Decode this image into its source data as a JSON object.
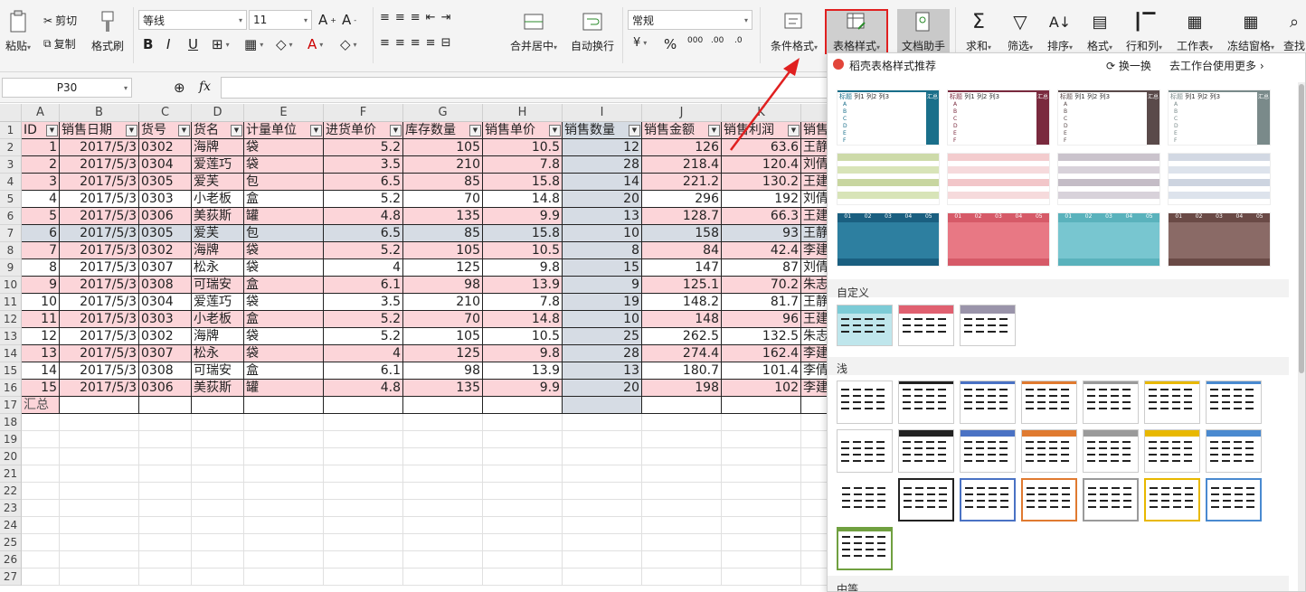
{
  "ribbon": {
    "paste": "粘贴",
    "cut": "剪切",
    "copy": "复制",
    "format_painter": "格式刷",
    "font_name": "等线",
    "font_size": "11",
    "merge_center": "合并居中",
    "wrap_text": "自动换行",
    "number_format": "常规",
    "cond_format": "条件格式",
    "table_style": "表格样式",
    "doc_helper": "文档助手",
    "sum": "求和",
    "filter": "筛选",
    "sort": "排序",
    "format": "格式",
    "row_col": "行和列",
    "worksheet": "工作表",
    "freeze": "冻结窗格",
    "find": "查找",
    "currency": "¥",
    "percent": "%",
    "thousands": "000",
    "inc_decimal": ".00",
    "dec_decimal": ".0"
  },
  "formula_bar": {
    "name_box": "P30",
    "fx": "fx"
  },
  "sheet": {
    "columns": [
      "A",
      "B",
      "C",
      "D",
      "E",
      "F",
      "G",
      "H",
      "I",
      "J",
      "K"
    ],
    "headers": [
      "ID",
      "销售日期",
      "货号",
      "货名",
      "计量单位",
      "进货单价",
      "库存数量",
      "销售单价",
      "销售数量",
      "销售金额",
      "销售利润",
      "销售"
    ],
    "rows": [
      [
        "1",
        "2017/5/3",
        "0302",
        "海牌",
        "袋",
        "5.2",
        "105",
        "10.5",
        "12",
        "126",
        "63.6",
        "王静"
      ],
      [
        "2",
        "2017/5/3",
        "0304",
        "爱莲巧",
        "袋",
        "3.5",
        "210",
        "7.8",
        "28",
        "218.4",
        "120.4",
        "刘倩"
      ],
      [
        "3",
        "2017/5/3",
        "0305",
        "爱芙",
        "包",
        "6.5",
        "85",
        "15.8",
        "14",
        "221.2",
        "130.2",
        "王建"
      ],
      [
        "4",
        "2017/5/3",
        "0303",
        "小老板",
        "盒",
        "5.2",
        "70",
        "14.8",
        "20",
        "296",
        "192",
        "刘倩"
      ],
      [
        "5",
        "2017/5/3",
        "0306",
        "美荻斯",
        "罐",
        "4.8",
        "135",
        "9.9",
        "13",
        "128.7",
        "66.3",
        "王建"
      ],
      [
        "6",
        "2017/5/3",
        "0305",
        "爱芙",
        "包",
        "6.5",
        "85",
        "15.8",
        "10",
        "158",
        "93",
        "王静"
      ],
      [
        "7",
        "2017/5/3",
        "0302",
        "海牌",
        "袋",
        "5.2",
        "105",
        "10.5",
        "8",
        "84",
        "42.4",
        "李建"
      ],
      [
        "8",
        "2017/5/3",
        "0307",
        "松永",
        "袋",
        "4",
        "125",
        "9.8",
        "15",
        "147",
        "87",
        "刘倩"
      ],
      [
        "9",
        "2017/5/3",
        "0308",
        "可瑞安",
        "盒",
        "6.1",
        "98",
        "13.9",
        "9",
        "125.1",
        "70.2",
        "朱志"
      ],
      [
        "10",
        "2017/5/3",
        "0304",
        "爱莲巧",
        "袋",
        "3.5",
        "210",
        "7.8",
        "19",
        "148.2",
        "81.7",
        "王静"
      ],
      [
        "11",
        "2017/5/3",
        "0303",
        "小老板",
        "盒",
        "5.2",
        "70",
        "14.8",
        "10",
        "148",
        "96",
        "王建"
      ],
      [
        "12",
        "2017/5/3",
        "0302",
        "海牌",
        "袋",
        "5.2",
        "105",
        "10.5",
        "25",
        "262.5",
        "132.5",
        "朱志"
      ],
      [
        "13",
        "2017/5/3",
        "0307",
        "松永",
        "袋",
        "4",
        "125",
        "9.8",
        "28",
        "274.4",
        "162.4",
        "李建"
      ],
      [
        "14",
        "2017/5/3",
        "0308",
        "可瑞安",
        "盒",
        "6.1",
        "98",
        "13.9",
        "13",
        "180.7",
        "101.4",
        "李倩"
      ],
      [
        "15",
        "2017/5/3",
        "0306",
        "美荻斯",
        "罐",
        "4.8",
        "135",
        "9.9",
        "20",
        "198",
        "102",
        "李建"
      ]
    ],
    "summary_label": "汇总",
    "row_numbers": [
      "1",
      "2",
      "3",
      "4",
      "5",
      "6",
      "7",
      "8",
      "9",
      "10",
      "11",
      "12",
      "13",
      "14",
      "15",
      "16",
      "17",
      "18",
      "19",
      "20",
      "21",
      "22",
      "23",
      "24",
      "25",
      "26",
      "27"
    ]
  },
  "panel": {
    "title": "稻壳表格样式推荐",
    "refresh": "换一换",
    "more": "去工作台使用更多",
    "custom": "自定义",
    "light": "浅",
    "medium": "中等",
    "thumb_labels": {
      "title": "标题",
      "col1": "列1",
      "col2": "列2",
      "col3": "列3",
      "total": "汇总",
      "rows": [
        "A",
        "B",
        "C",
        "D",
        "E",
        "F"
      ],
      "nums": [
        "01",
        "02",
        "03",
        "04",
        "05"
      ]
    }
  },
  "colors": {
    "pink": "#fcd5d9",
    "blue_gray": "#d6dce4",
    "accent_red": "#e02020",
    "wps_red": "#e2453a"
  }
}
